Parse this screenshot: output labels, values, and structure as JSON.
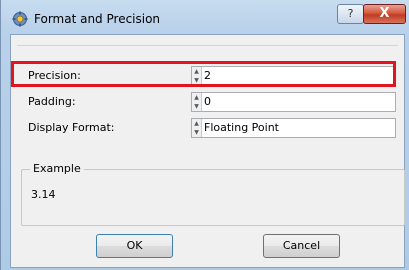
{
  "window": {
    "title": "Format and Precision",
    "help_glyph": "?",
    "close_glyph": "X"
  },
  "fields": [
    {
      "label": "Precision:",
      "value": "2"
    },
    {
      "label": "Padding:",
      "value": "0"
    },
    {
      "label": "Display Format:",
      "value": "Floating Point"
    }
  ],
  "example": {
    "legend": "Example",
    "value": "3.14"
  },
  "buttons": {
    "ok_label": "OK",
    "cancel_label": "Cancel"
  },
  "icons": {
    "app": "app-gear-icon",
    "spin_up": "spin-up-arrow-icon",
    "spin_down": "spin-down-arrow-icon"
  },
  "colors": {
    "highlight_border": "#e4141e",
    "close_button": "#c13b22"
  }
}
